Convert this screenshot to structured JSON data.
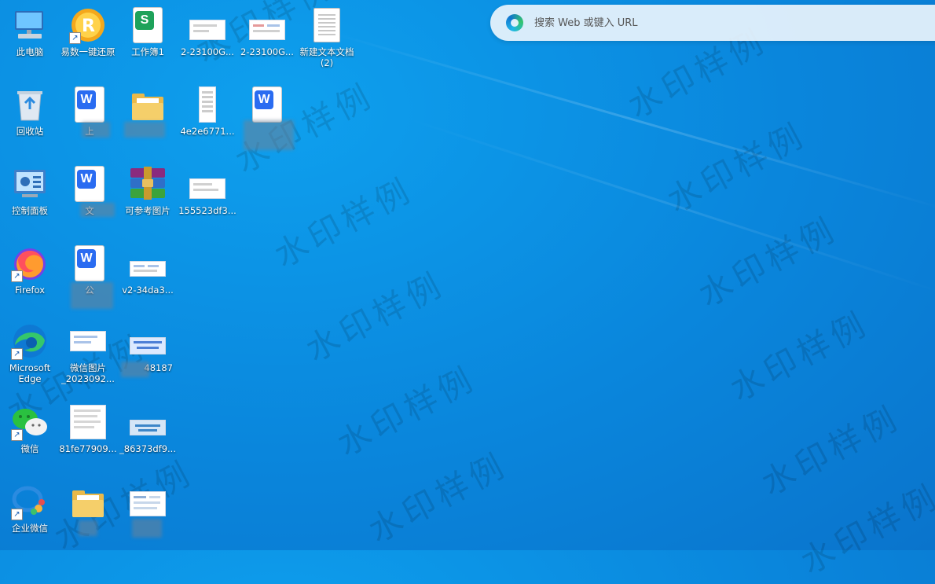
{
  "search": {
    "placeholder": "搜索 Web 或键入 URL"
  },
  "watermark": {
    "text": "水印样例"
  },
  "icons": {
    "this_pc": "此电脑",
    "yishu": "易数一键还原",
    "workbook": "工作簿1",
    "img1": "2-23100G...",
    "img2": "2-23100G...",
    "new_txt": "新建文本文档 (2)",
    "recycle": "回收站",
    "doc_shang": "上",
    "folder_blur": "",
    "file_4e2": "4e2e6771...",
    "doc_wps2": "",
    "control_panel": "控制面板",
    "doc_wen": "文",
    "rar_ref": "可参考图片",
    "img_155": "155523df3...",
    "firefox": "Firefox",
    "doc_gong": "公",
    "img_v2": "v2-34da3...",
    "edge": "Microsoft Edge",
    "wechat_img": "微信图片_2023092...",
    "img_48187": "48187",
    "wechat": "微信",
    "img_81fe": "81fe77909...",
    "img_86373": "_86373df9...",
    "wecom": "企业微信",
    "folder_bottom": "",
    "img_bottom": ""
  }
}
